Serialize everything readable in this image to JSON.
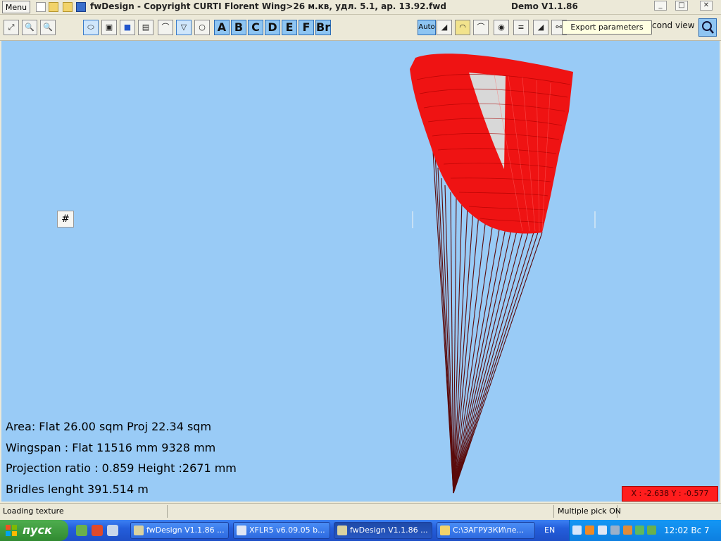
{
  "window": {
    "menu_label": "Menu",
    "title": "fwDesign - Copyright CURTI Florent    Wing>26 м.кв, удл. 5.1, ар. 13.92.fwd",
    "version": "Demo V1.1.86"
  },
  "toolbar": {
    "profile_letters": [
      "A",
      "B",
      "C",
      "D",
      "E",
      "F",
      "Br"
    ],
    "auto_label": "Auto",
    "tooltip": "Export parameters",
    "second_view_label": "cond view"
  },
  "viewport": {
    "grid_icon": "grid-icon",
    "info": {
      "area": "Area: Flat 26.00 sqm   Proj 22.34 sqm",
      "wingspan": "Wingspan : Flat 11516 mm   9328 mm",
      "projection": "Projection ratio : 0.859 Height :2671 mm",
      "bridles": "Bridles lenght 391.514 m"
    },
    "coords": "X : -2.638 Y : -0.577",
    "colors": {
      "background": "#99cbf6",
      "canopy": "#ef1313",
      "lines": "#5a0a0a",
      "coord_box": "#ff1d1d"
    }
  },
  "status": {
    "left": "Loading texture",
    "right": "Multiple pick ON"
  },
  "taskbar": {
    "start": "пуск",
    "tasks": [
      "fwDesign V1.1.86 ...",
      "XFLR5 v6.09.05 b...",
      "fwDesign V1.1.86 ...",
      "C:\\ЗАГРУЗКИ\\пе..."
    ],
    "lang": "EN",
    "clock": "12:02 Вс 7"
  }
}
